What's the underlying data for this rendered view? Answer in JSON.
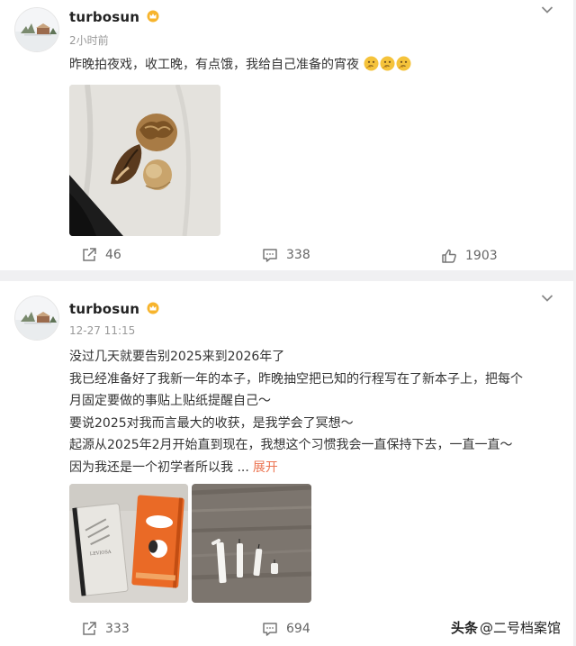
{
  "posts": [
    {
      "username": "turbosun",
      "time": "2小时前",
      "text_lines": [
        "昨晚拍夜戏，收工晚，有点饿，我给自己准备的宵夜"
      ],
      "emojis": [
        "thinking-face-emoji",
        "thinking-face-emoji",
        "thinking-face-emoji"
      ],
      "images": [
        "nuts-photo"
      ],
      "repost_count": "46",
      "comment_count": "338",
      "like_count": "1903"
    },
    {
      "username": "turbosun",
      "time": "12-27 11:15",
      "text_lines": [
        "没过几天就要告别2025来到2026年了",
        "我已经准备好了我新一年的本子，昨晚抽空把已知的行程写在了新本子上，把每个",
        "月固定要做的事贴上贴纸提醒自己～",
        "要说2025对我而言最大的收获，是我学会了冥想～",
        "起源从2025年2月开始直到现在，我想这个习惯我会一直保持下去，一直一直～",
        "因为我还是一个初学者所以我 ..."
      ],
      "expand_label": "展开",
      "images": [
        "notebooks-photo",
        "candles-photo"
      ],
      "repost_count": "333",
      "comment_count": "694"
    }
  ],
  "watermark": {
    "platform": "头条",
    "handle": "@二号档案馆"
  },
  "colors": {
    "expand_link": "#eb7350",
    "secondary_text": "#999999",
    "page_background": "#f0f0f2"
  }
}
